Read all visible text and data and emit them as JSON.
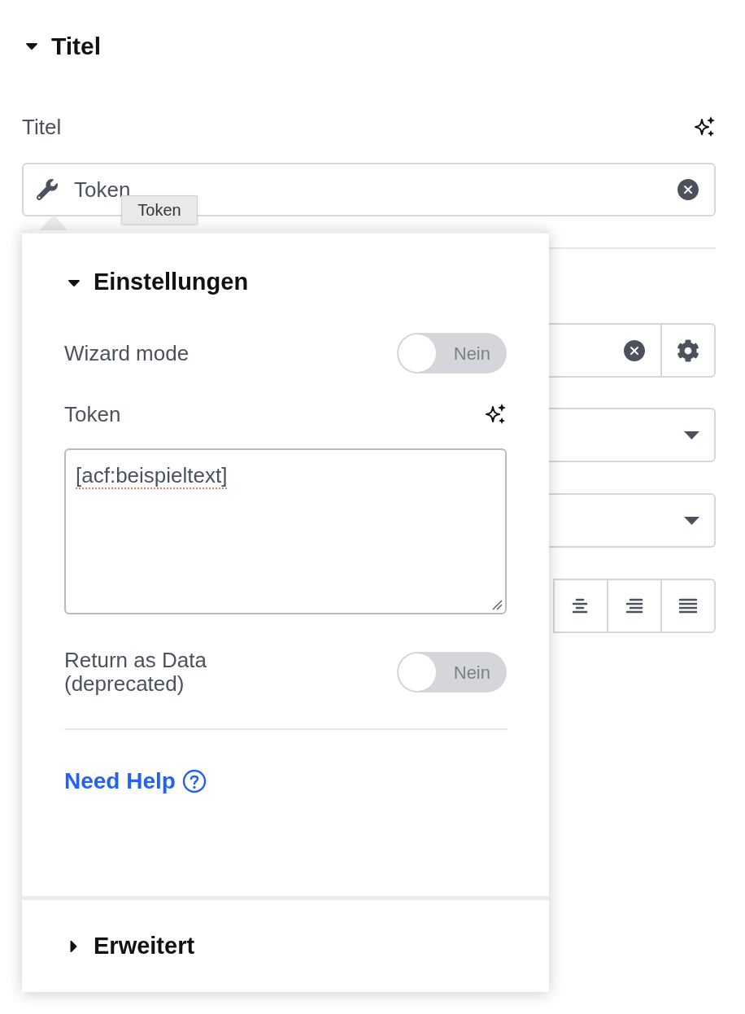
{
  "section": {
    "title": "Titel",
    "expanded": true
  },
  "field": {
    "label": "Titel",
    "value": "Token"
  },
  "tooltip": "Token",
  "popover": {
    "settings": {
      "title": "Einstellungen",
      "expanded": true,
      "rows": [
        {
          "kind": "toggle",
          "label": "Wizard mode",
          "on": false,
          "state_text": "Nein"
        },
        {
          "kind": "textarea",
          "label": "Token",
          "value": "[acf:beispieltext]"
        },
        {
          "kind": "toggle",
          "label": "Return as Data\n(deprecated)",
          "on": false,
          "state_text": "Nein"
        }
      ],
      "help_link": "Need Help"
    },
    "advanced": {
      "title": "Erweitert",
      "expanded": false
    }
  }
}
